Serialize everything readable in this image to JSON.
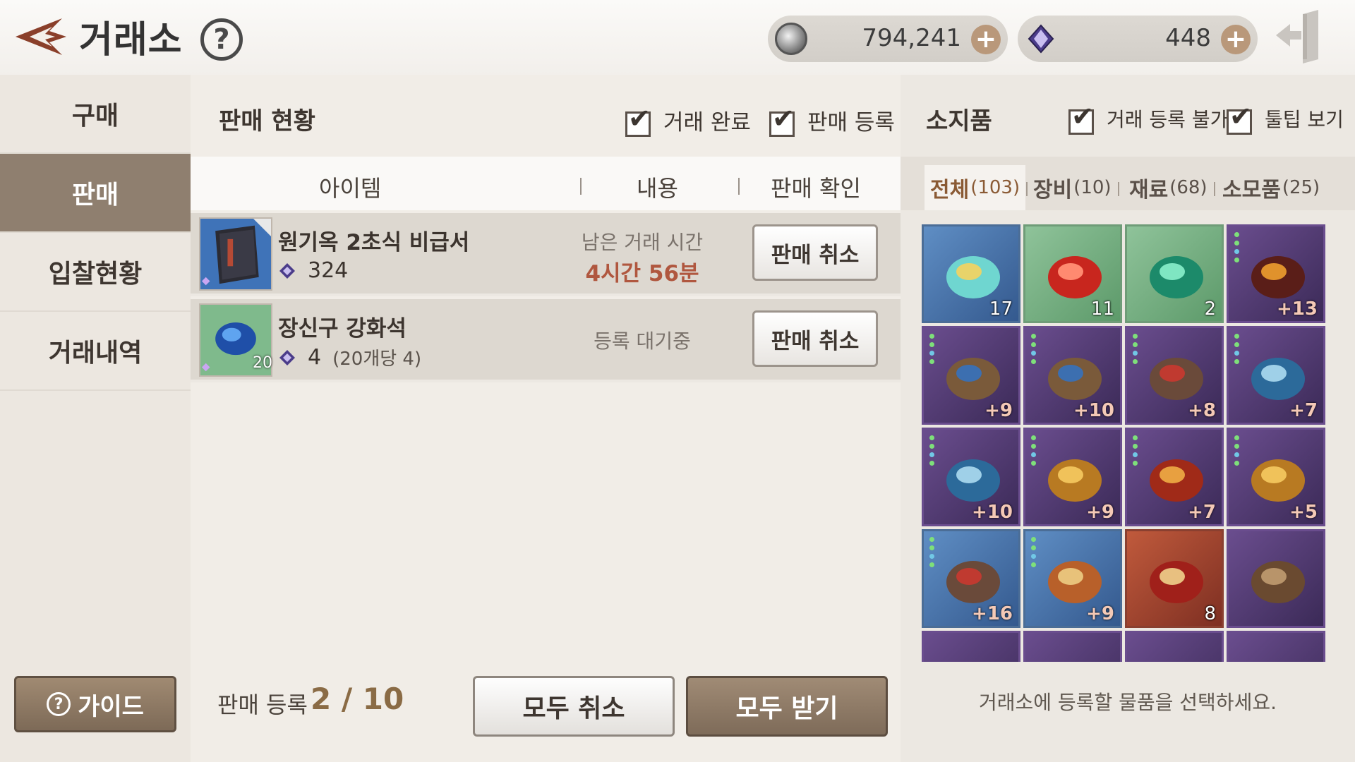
{
  "header": {
    "title": "거래소",
    "help_label": "?",
    "gold_amount": "794,241",
    "gem_amount": "448",
    "plus_label": "+"
  },
  "nav": {
    "items": [
      {
        "label": "구매",
        "active": false
      },
      {
        "label": "판매",
        "active": true
      },
      {
        "label": "입찰현황",
        "active": false
      },
      {
        "label": "거래내역",
        "active": false
      }
    ],
    "guide_label": "가이드",
    "guide_icon": "?"
  },
  "sales": {
    "title": "판매 현황",
    "filter_done": "거래 완료",
    "filter_registered": "판매 등록",
    "columns": [
      "아이템",
      "내용",
      "판매 확인"
    ],
    "rows": [
      {
        "name": "원기옥 2초식 비급서",
        "price": "324",
        "price_note": "",
        "status_label": "남은 거래 시간",
        "status_value": "4시간 56분",
        "button": "판매 취소"
      },
      {
        "name": "장신구 강화석",
        "price": "4",
        "price_note": "(20개당 4)",
        "stack": "20",
        "status_label": "등록 대기중",
        "status_value": "",
        "button": "판매 취소"
      }
    ],
    "register_label": "판매 등록",
    "register_count": "2 / 10",
    "cancel_all": "모두 취소",
    "receive_all": "모두 받기"
  },
  "inventory": {
    "title": "소지품",
    "filter_untradable": "거래 등록 불가",
    "filter_tooltip": "툴팁 보기",
    "tabs": [
      {
        "label": "전체",
        "count": "(103)",
        "active": true
      },
      {
        "label": "장비",
        "count": "(10)",
        "active": false
      },
      {
        "label": "재료",
        "count": "(68)",
        "active": false
      },
      {
        "label": "소모품",
        "count": "(25)",
        "active": false
      }
    ],
    "items": [
      {
        "style": "blue",
        "icon": "scroll-icon",
        "stack": "17",
        "enh": ""
      },
      {
        "style": "green",
        "icon": "red-stone-icon",
        "stack": "11",
        "enh": ""
      },
      {
        "style": "green",
        "icon": "green-stone-icon",
        "stack": "2",
        "enh": ""
      },
      {
        "style": "purple",
        "icon": "feather-accessory-icon",
        "stack": "",
        "enh": "+13"
      },
      {
        "style": "purple",
        "icon": "ring-icon",
        "stack": "",
        "enh": "+9"
      },
      {
        "style": "purple",
        "icon": "ring-icon",
        "stack": "",
        "enh": "+10"
      },
      {
        "style": "purple",
        "icon": "bracelet-icon",
        "stack": "",
        "enh": "+8"
      },
      {
        "style": "purple",
        "icon": "necklace-icon",
        "stack": "",
        "enh": "+7"
      },
      {
        "style": "purple",
        "icon": "necklace-icon",
        "stack": "",
        "enh": "+10"
      },
      {
        "style": "purple",
        "icon": "earring-icon",
        "stack": "",
        "enh": "+9"
      },
      {
        "style": "purple",
        "icon": "glove-icon",
        "stack": "",
        "enh": "+7"
      },
      {
        "style": "purple",
        "icon": "earring-icon",
        "stack": "",
        "enh": "+5"
      },
      {
        "style": "blue",
        "icon": "bracelet-icon",
        "stack": "",
        "enh": "+16"
      },
      {
        "style": "blue",
        "icon": "weapon-icon",
        "stack": "",
        "enh": "+9"
      },
      {
        "style": "red",
        "icon": "box-icon",
        "stack": "8",
        "enh": ""
      },
      {
        "style": "purple",
        "icon": "wood-icon",
        "stack": "",
        "enh": ""
      },
      {
        "style": "purple",
        "icon": "material-icon",
        "stack": "",
        "enh": ""
      },
      {
        "style": "purple",
        "icon": "material-icon",
        "stack": "",
        "enh": ""
      },
      {
        "style": "purple",
        "icon": "material-icon",
        "stack": "",
        "enh": ""
      },
      {
        "style": "purple",
        "icon": "material-icon",
        "stack": "",
        "enh": ""
      }
    ],
    "hint": "거래소에 등록할 물품을 선택하세요."
  },
  "colors": {
    "accent_brown": "#8f7f6f",
    "time_red": "#b0573f",
    "count_gold": "#8a6b45"
  }
}
